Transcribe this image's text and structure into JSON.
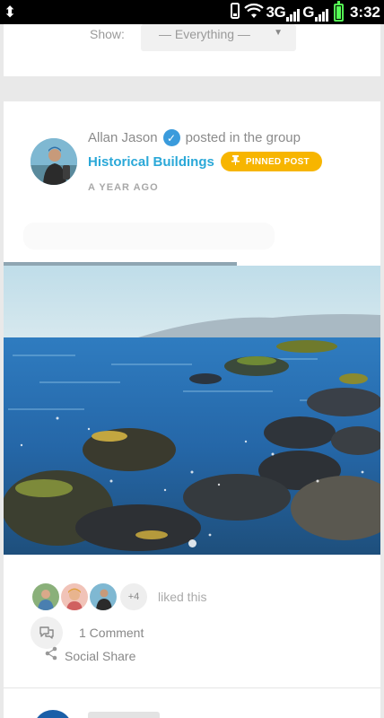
{
  "status_bar": {
    "usb_icon": "usb-icon",
    "network_1": "3G",
    "network_2": "G",
    "time": "3:32"
  },
  "filter": {
    "label": "Show:",
    "selected": "— Everything —"
  },
  "post": {
    "author": "Allan Jason",
    "posted_in_text": "posted in the group",
    "group_name": "Historical Buildings",
    "pinned_label": "PINNED POST",
    "time_ago": "A YEAR AGO",
    "media_progress": 0.62,
    "likes": {
      "more_count": "+4",
      "liked_text": "liked this"
    },
    "comments_text": "1 Comment",
    "share_text": "Social Share"
  },
  "colors": {
    "accent_link": "#2aa8d8",
    "pinned_badge": "#f7b500",
    "verified": "#3a9bdc"
  }
}
